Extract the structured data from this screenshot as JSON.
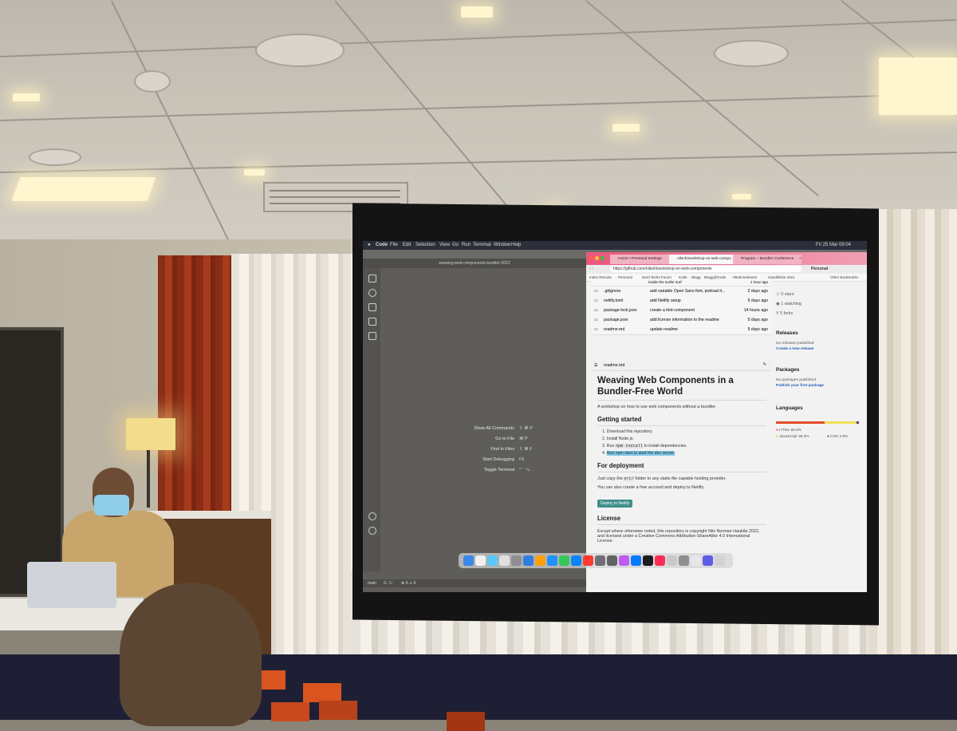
{
  "screen": {
    "menubar": {
      "app": "Code",
      "items": [
        "File",
        "Edit",
        "Selection",
        "View",
        "Go",
        "Run",
        "Terminal",
        "Window",
        "Help"
      ],
      "clock": "Fri 25 Mar  09:04"
    },
    "vscode": {
      "title": "weaving-web-components-bundler-2022",
      "shortcuts": [
        {
          "label": "Show All Commands",
          "keys": "⇧  ⌘  P"
        },
        {
          "label": "Go to File",
          "keys": "⌘  P"
        },
        {
          "label": "Find in Files",
          "keys": "⇧  ⌘  F"
        },
        {
          "label": "Start Debugging",
          "keys": "F5"
        },
        {
          "label": "Toggle Terminal",
          "keys": "^  `  ⌥"
        }
      ],
      "status_branch": "main",
      "status_sync": "0↓ 1↑",
      "status_problems": "⊗ 0  ⚠ 0"
    },
    "browser": {
      "tabs": [
        {
          "title": "Home • Personal Settings"
        },
        {
          "title": "nilsnh/workshop-on-web-compo"
        },
        {
          "title": "Program – Bundler Conference"
        },
        {
          "title": "+"
        }
      ],
      "url": "https://github.com/nilsnh/workshop-on-web-components",
      "profile": "Personal",
      "bookmarks": [
        "Index Remote",
        "Personal",
        "Nerd Techs Forum",
        "Kode",
        "Blogg",
        "Blogg@Gode",
        "#Bokmerkemer",
        "Handleliste 2021",
        "Other Bookmarks"
      ],
      "files": [
        {
          "name": ".gitignore",
          "message": "add variable Open Sans font, preload it...",
          "time": "2 days ago"
        },
        {
          "name": "netlify.toml",
          "message": "add Netlify setup",
          "time": "5 days ago"
        },
        {
          "name": "package-lock.json",
          "message": "create a hint-component",
          "time": "14 hours ago"
        },
        {
          "name": "package.json",
          "message": "add license information to the readme",
          "time": "5 days ago"
        },
        {
          "name": "readme.md",
          "message": "update readme",
          "time": "5 days ago"
        }
      ],
      "top_cut_message": "inside the surfer surf",
      "top_cut_time": "1 hour ago",
      "readme_filename": "readme.md",
      "readme": {
        "title": "Weaving Web Components in a Bundler-Free World",
        "intro": "A workshop on how to use web components without a bundler.",
        "getting_started": "Getting started",
        "steps": [
          "Download this repository.",
          "Install Node.js.",
          "Run npm install to install dependencies.",
          "Run npm start to start the dev server."
        ],
        "step3_pre": "Run ",
        "step3_code": "npm install",
        "step3_post": " to install dependencies.",
        "step4_text": "Run npm start to start the dev server.",
        "deployment": "For deployment",
        "deploy_p1_pre": "Just copy the ",
        "deploy_p1_code": "src/",
        "deploy_p1_post": " folder to any static-file capable hosting provider.",
        "deploy_p2": "You can also create a free account and deploy to Netlify.",
        "netlify_button": "Deploy to Netlify",
        "license": "License",
        "license_text": "Except where otherwise noted, this repository is copyright Nils Norman Haukås 2022, and licensed under a Creative Commons Attribution-ShareAlike 4.0 International License."
      },
      "sidebar": {
        "stars": "0 stars",
        "watching": "1 watching",
        "forks": "0 forks",
        "releases": "Releases",
        "releases_none": "No releases published",
        "releases_link": "Create a new release",
        "packages": "Packages",
        "packages_none": "No packages published",
        "packages_link": "Publish your first package",
        "languages": "Languages",
        "lang_html": "HTML 58.8%",
        "lang_js": "JavaScript 38.3%",
        "lang_css": "CSS 2.9%"
      }
    },
    "dock_count": 22
  },
  "languages_bar": [
    {
      "name": "HTML",
      "percent": 58.8,
      "color": "#e34c26"
    },
    {
      "name": "JavaScript",
      "percent": 38.3,
      "color": "#f1e05a"
    },
    {
      "name": "CSS",
      "percent": 2.9,
      "color": "#563d7c"
    }
  ]
}
